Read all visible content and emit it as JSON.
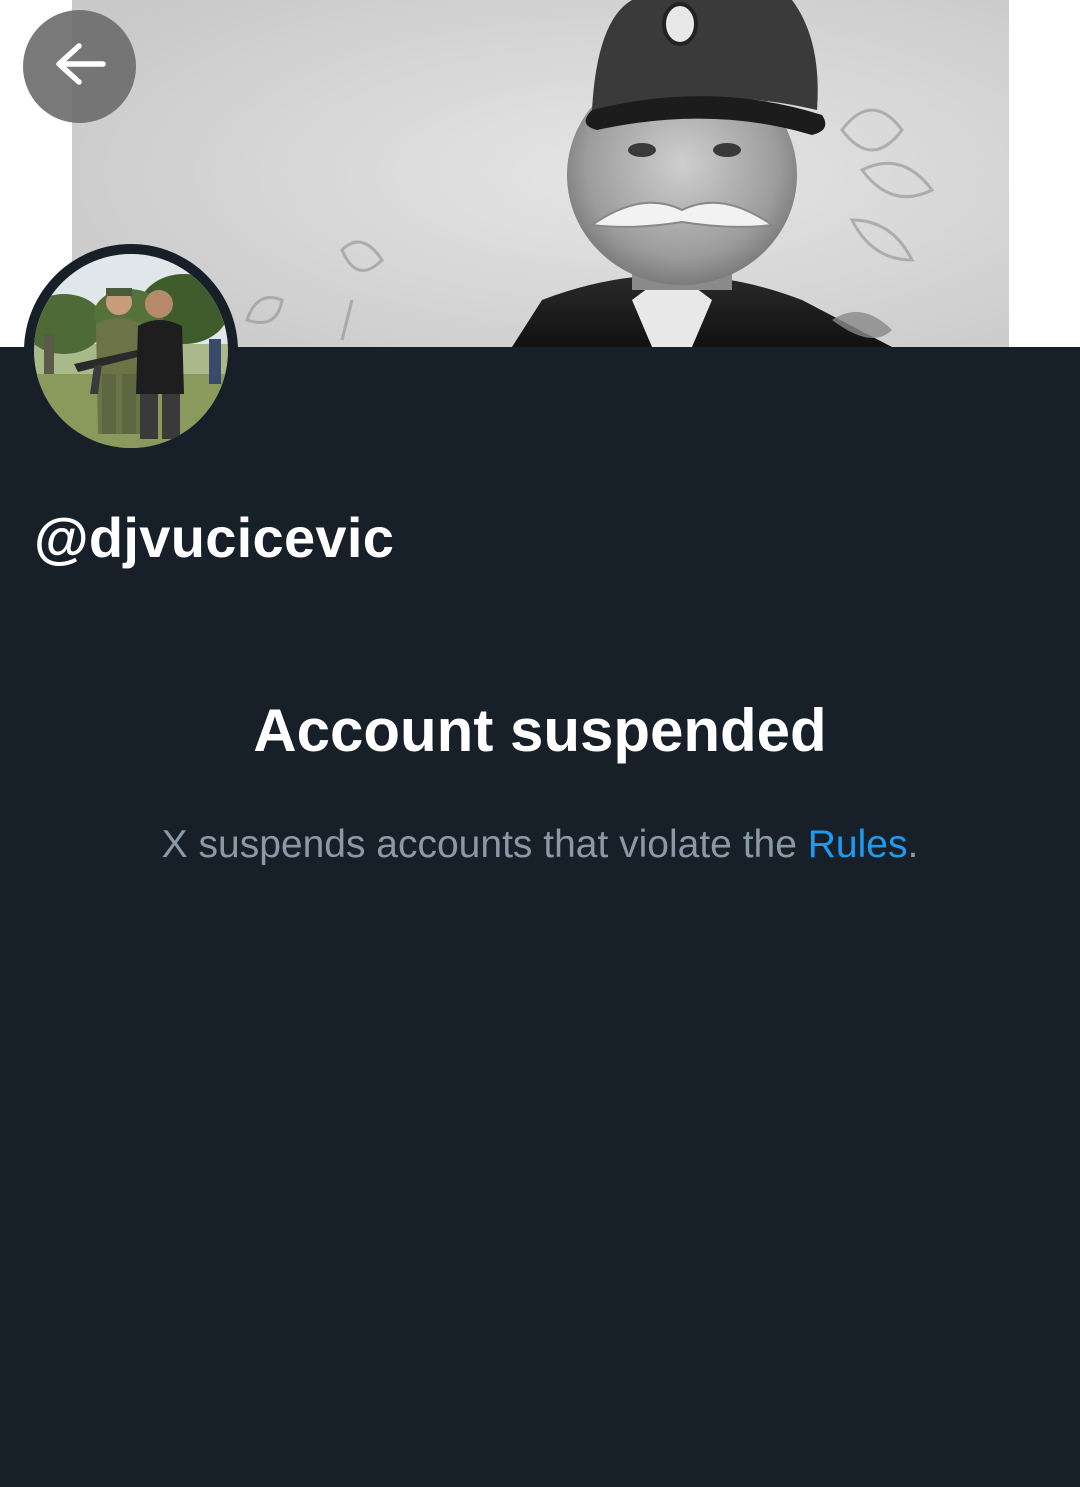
{
  "profile": {
    "handle": "@djvucicevic",
    "back_icon": "arrow-left-icon"
  },
  "suspension": {
    "title": "Account suspended",
    "message_prefix": "X suspends accounts that violate the ",
    "rules_link": "Rules",
    "message_suffix": "."
  },
  "colors": {
    "background": "#171f29",
    "text_primary": "#ffffff",
    "text_secondary": "#8b98a5",
    "link": "#1d9bf0"
  }
}
